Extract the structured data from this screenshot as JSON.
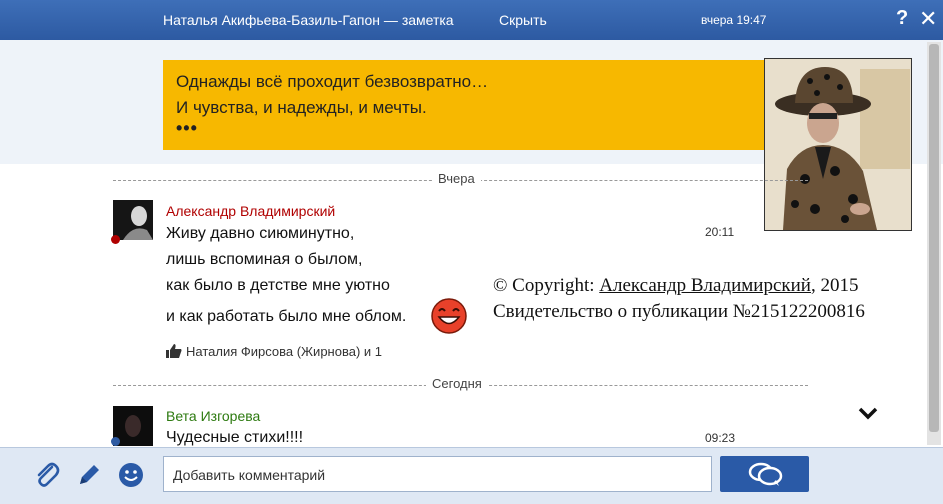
{
  "titlebar": {
    "title": "Наталья Акифьева-Базиль-Гапон — заметка",
    "hide_label": "Скрыть",
    "time": "вчера 19:47",
    "help_icon": "?",
    "close_icon": "✕"
  },
  "note": {
    "line1": "Однажды всё проходит безвозвратно…",
    "line2": "И чувства, и надежды, и мечты.",
    "dots": "•••"
  },
  "separators": {
    "yesterday": "Вчера",
    "today": "Сегодня"
  },
  "comments": [
    {
      "author": "Александр Владимирский",
      "lines": [
        "Живу давно сиюминутно,",
        "лишь вспоминая о былом,",
        "как было в детстве мне уютно",
        "и как работать было мне облом."
      ],
      "time": "20:11",
      "likes": "Наталия Фирсова (Жирнова) и 1"
    },
    {
      "author": "Вета Изгорева",
      "lines": [
        "Чудесные стихи!!!!"
      ],
      "time": "09:23"
    }
  ],
  "copyright": {
    "prefix": "© Copyright: ",
    "author": "Александр Владимирский",
    "year": ", 2015",
    "certificate": "Свидетельство о публикации №215122200816"
  },
  "composer": {
    "placeholder": "Добавить комментарий"
  },
  "colors": {
    "titlebar": "#2d5aa2",
    "note_bg": "#f7b800",
    "author_red": "#b00000",
    "author_green": "#2d7a10"
  }
}
